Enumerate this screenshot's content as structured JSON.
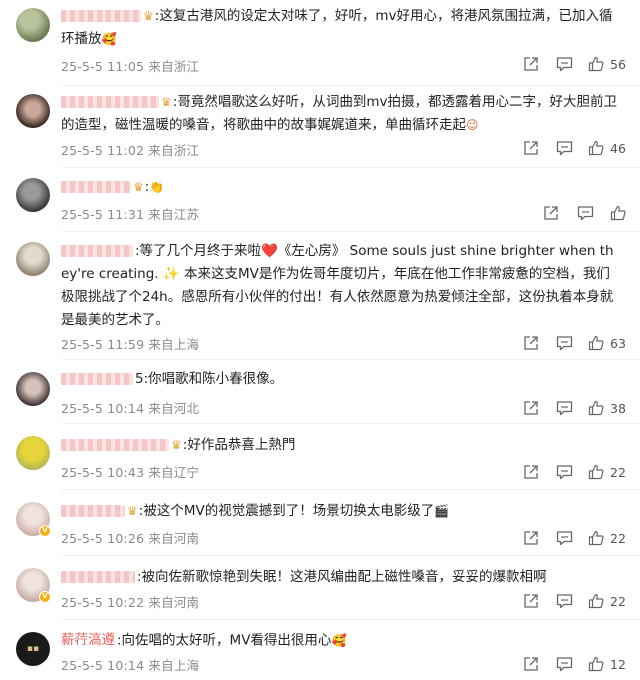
{
  "comments": [
    {
      "name_text": "",
      "text": ":这复古港风的设定太对味了，好听，mv好用心，将港风氛围拉满，已加入循环播放",
      "emoji": "🥰",
      "date": "25-5-5 11:05",
      "location": "来自浙江",
      "likes": "56",
      "avatar_colors": [
        "#6f7a57",
        "#b9c39b"
      ]
    },
    {
      "name_text": "",
      "text": ":哥竟然唱歌这么好听，从词曲到mv拍摄，都透露着用心二字，好大胆前卫的造型，磁性温暖的嗓音，将歌曲中的故事娓娓道来，单曲循环走起",
      "emoji": "😉",
      "date": "25-5-5 11:02",
      "location": "来自浙江",
      "likes": "46",
      "avatar_colors": [
        "#3a2a25",
        "#c9a79a"
      ]
    },
    {
      "name_text": "",
      "text": ":",
      "emoji": "👏",
      "date": "25-5-5 11:31",
      "location": "来自江苏",
      "likes": "",
      "avatar_colors": [
        "#2e2e2e",
        "#9a9a9a"
      ]
    },
    {
      "name_text": "",
      "text": ":等了几个月终于来啦❤️《左心房》 Some souls just shine brighter when they're creating. ✨ 本来这支MV是作为佐哥年度切片，年底在他工作非常疲惫的空档，我们极限挑战了个24h。感恩所有小伙伴的付出！有人依然愿意为热爱倾注全部，这份执着本身就是最美的艺术了。",
      "emoji": "",
      "date": "25-5-5 11:59",
      "location": "来自上海",
      "likes": "63",
      "avatar_colors": [
        "#8b7d6b",
        "#e2dbd0"
      ]
    },
    {
      "name_text": "",
      "text": "5:你唱歌和陈小春很像。",
      "emoji": "",
      "date": "25-5-5 10:14",
      "location": "来自河北",
      "likes": "38",
      "avatar_colors": [
        "#3b3030",
        "#d6c2bb"
      ]
    },
    {
      "name_text": "",
      "text": ":好作品恭喜上熱門",
      "emoji": "",
      "date": "25-5-5 10:43",
      "location": "来自辽宁",
      "likes": "22",
      "avatar_colors": [
        "#e7d43b",
        "#a8b05a"
      ]
    },
    {
      "name_text": "",
      "text": ":被这个MV的视觉震撼到了！场景切换太电影级了",
      "emoji": "🎬",
      "date": "25-5-5 10:26",
      "location": "来自河南",
      "likes": "22",
      "avatar_colors": [
        "#c9a9a0",
        "#f0e3de"
      ]
    },
    {
      "name_text": "",
      "text": ":被向佐新歌惊艳到失眠！这港风编曲配上磁性嗓音，妥妥的爆款相啊",
      "emoji": "",
      "date": "25-5-5 10:22",
      "location": "来自河南",
      "likes": "22",
      "avatar_colors": [
        "#bfa49a",
        "#efe4df"
      ]
    },
    {
      "name_text": "薪荇滈遵",
      "text": ":向佐唱的太好听，MV看得出很用心",
      "emoji": "🥰",
      "date": "25-5-5 10:14",
      "location": "来自上海",
      "likes": "12",
      "avatar_colors": [
        "#1a1a1a",
        "#d9c089"
      ]
    }
  ],
  "colors": {
    "meta": "#8a8a8a",
    "username_blur": "#f4c6c6",
    "crown": "#e9a43a",
    "vip_badge": "#f6b00f"
  },
  "icons": [
    "share-icon",
    "comment-icon",
    "like-icon"
  ]
}
